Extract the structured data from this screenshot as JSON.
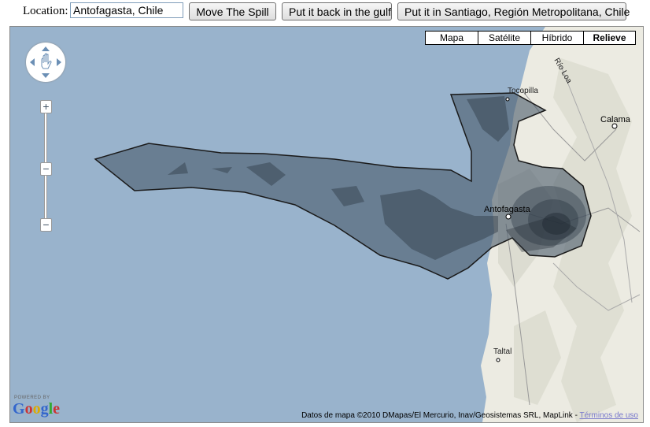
{
  "toolbar": {
    "location_label": "Location:",
    "location_value": "Antofagasta, Chile",
    "move_button": "Move The Spill",
    "gulf_button": "Put it back in the gulf",
    "santiago_button": "Put it in Santiago, Región Metropolitana, Chile"
  },
  "map_types": [
    {
      "label": "Mapa",
      "active": false
    },
    {
      "label": "Satélite",
      "active": false
    },
    {
      "label": "Híbrido",
      "active": false
    },
    {
      "label": "Relieve",
      "active": true
    }
  ],
  "places": {
    "tocopilla": "Tocopilla",
    "calama": "Calama",
    "antofagasta": "Antofagasta",
    "taltal": "Taltal",
    "rio_loa": "Río Loa"
  },
  "footer": {
    "powered_by": "POWERED BY",
    "google": "Google",
    "attribution": "Datos de mapa ©2010 DMapas/El Mercurio, Inav/Geosistemas SRL, MapLink - ",
    "terms": "Términos de uso"
  },
  "controls": {
    "zoom_in": "+",
    "zoom_out": "−",
    "zoom_mid": "−"
  },
  "colors": {
    "ocean": "#99b3cc",
    "land": "#e8e8e0",
    "spill_fill": "#4a5a6a",
    "spill_dark": "#2e3a45"
  }
}
